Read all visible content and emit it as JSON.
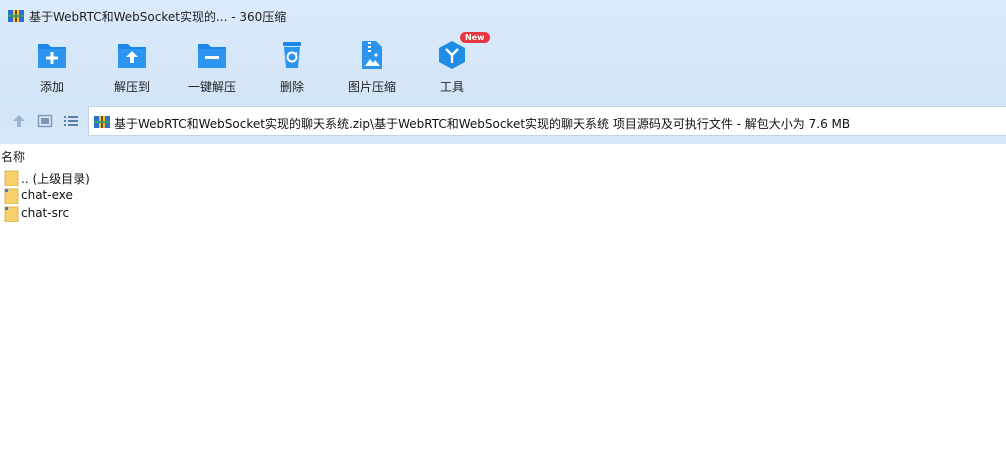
{
  "window": {
    "title": "基于WebRTC和WebSocket实现的... - 360压缩"
  },
  "toolbar": {
    "buttons": [
      {
        "label": "添加",
        "icon": "add-file-icon"
      },
      {
        "label": "解压到",
        "icon": "extract-to-icon"
      },
      {
        "label": "一键解压",
        "icon": "one-click-extract-icon"
      },
      {
        "label": "删除",
        "icon": "delete-icon"
      },
      {
        "label": "图片压缩",
        "icon": "image-compress-icon"
      },
      {
        "label": "工具",
        "icon": "tools-icon",
        "badge": "New"
      }
    ]
  },
  "address": {
    "path": "基于WebRTC和WebSocket实现的聊天系统.zip\\基于WebRTC和WebSocket实现的聊天系统 项目源码及可执行文件 - 解包大小为 7.6 MB"
  },
  "file_list": {
    "column_name": "名称",
    "rows": [
      {
        "name": ".. (上级目录)",
        "icon": "parent-folder-icon"
      },
      {
        "name": "chat-exe",
        "icon": "folder-icon"
      },
      {
        "name": "chat-src",
        "icon": "folder-icon"
      }
    ]
  },
  "colors": {
    "accent": "#1f8ce6",
    "chrome_bg": "#d6e7f9",
    "badge": "#e8363f",
    "folder": "#f5d26b"
  }
}
